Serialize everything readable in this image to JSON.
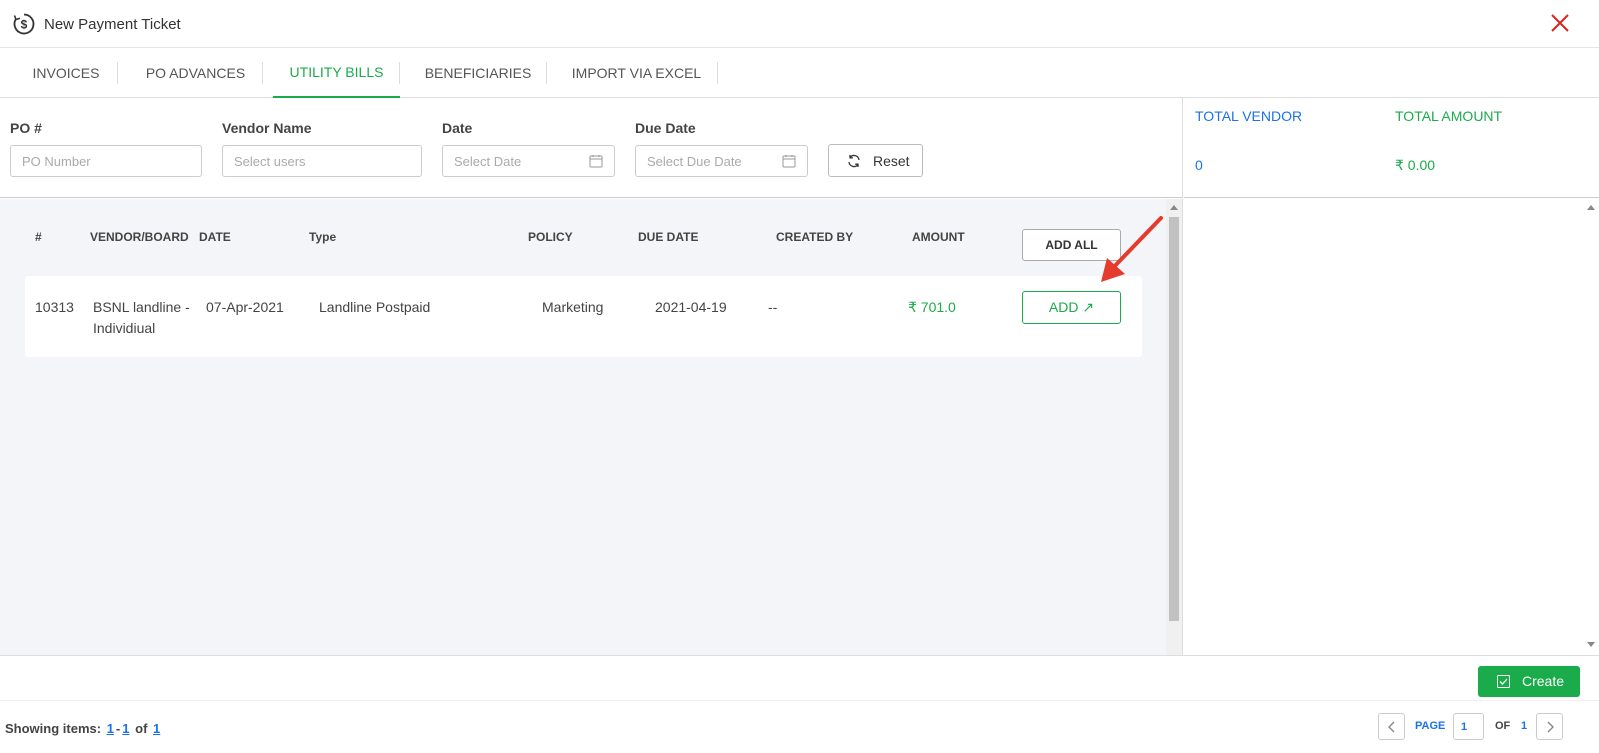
{
  "header": {
    "title": "New Payment Ticket"
  },
  "tabs": [
    {
      "label": "INVOICES"
    },
    {
      "label": "PO ADVANCES"
    },
    {
      "label": "UTILITY BILLS"
    },
    {
      "label": "BENEFICIARIES"
    },
    {
      "label": "IMPORT VIA EXCEL"
    }
  ],
  "active_tab": "UTILITY BILLS",
  "filters": {
    "po": {
      "label": "PO #",
      "placeholder": "PO Number"
    },
    "vendor": {
      "label": "Vendor Name",
      "placeholder": "Select users"
    },
    "date": {
      "label": "Date",
      "placeholder": "Select Date"
    },
    "due_date": {
      "label": "Due Date",
      "placeholder": "Select Due Date"
    },
    "reset_label": "Reset"
  },
  "totals": {
    "vendor_label": "TOTAL VENDOR",
    "vendor_value": "0",
    "amount_label": "TOTAL AMOUNT",
    "amount_value": "₹ 0.00"
  },
  "table": {
    "columns": [
      "#",
      "VENDOR/BOARD",
      "DATE",
      "Type",
      "POLICY",
      "DUE DATE",
      "CREATED BY",
      "AMOUNT"
    ],
    "add_all_label": "ADD ALL",
    "rows": [
      {
        "id": "10313",
        "vendor_line1": "BSNL landline -",
        "vendor_line2": "Individiual",
        "date": "07-Apr-2021",
        "type": "Landline Postpaid",
        "policy": "Marketing",
        "due_date": "2021-04-19",
        "created_by": "--",
        "amount": "₹  701.0",
        "add_label": "ADD ↗"
      }
    ]
  },
  "actions": {
    "create_label": "Create"
  },
  "footer": {
    "showing_label": "Showing items:",
    "range_start": "1",
    "range_sep": "-",
    "range_end": "1",
    "of_label": "of",
    "total": "1",
    "page_label": "PAGE",
    "page_value": "1",
    "of_pages_label": "OF",
    "total_pages": "1"
  },
  "colors": {
    "accent_green": "#1aab4b",
    "link_blue": "#1a73e8",
    "close_red": "#d9261c",
    "annotation_red": "#e53b2c"
  }
}
